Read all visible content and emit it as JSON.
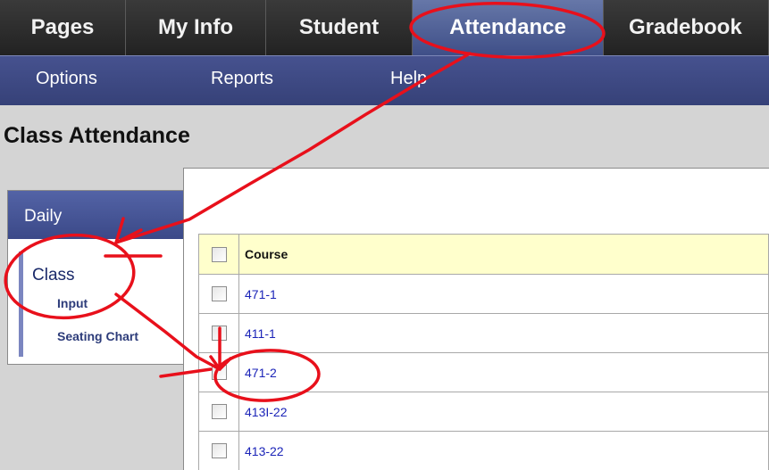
{
  "tabs": [
    {
      "label": "Pages",
      "active": false
    },
    {
      "label": "My Info",
      "active": false
    },
    {
      "label": "Student",
      "active": false
    },
    {
      "label": "Attendance",
      "active": true
    },
    {
      "label": "Gradebook",
      "active": false
    }
  ],
  "subnav": [
    "Options",
    "Reports",
    "Help"
  ],
  "page_title": "Class Attendance",
  "side": {
    "header": "Daily",
    "class_label": "Class",
    "items": [
      "Input",
      "Seating Chart"
    ]
  },
  "table": {
    "header": "Course",
    "rows": [
      "471-1",
      "411-1",
      "471-2",
      "413I-22",
      "413-22"
    ]
  },
  "colors": {
    "active_tab": "#4f5f98",
    "subnav": "#3e4a84",
    "header_row": "#ffffcc",
    "link": "#1b24b8",
    "annotation": "#e8101b"
  }
}
